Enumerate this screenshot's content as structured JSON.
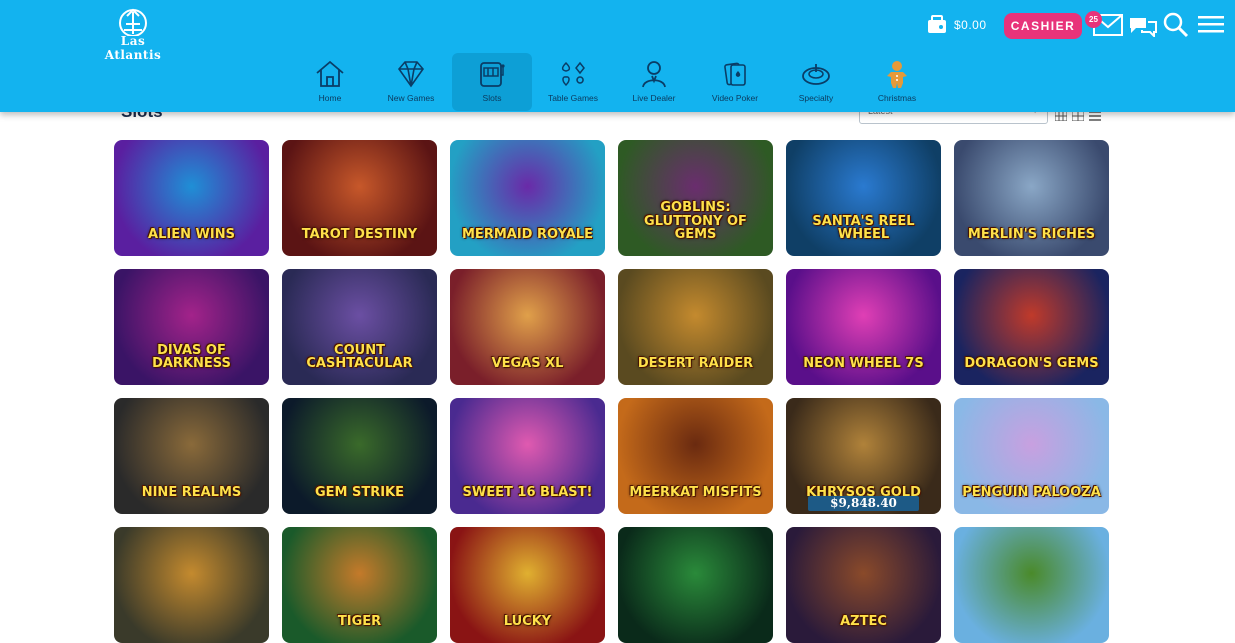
{
  "header": {
    "logo_text": "Las Atlantis",
    "balance": "$0.00",
    "cashier_label": "CASHIER",
    "mail_badge": "25",
    "icons": [
      "wallet-icon",
      "mail-icon",
      "chat-icon",
      "search-icon",
      "menu-icon"
    ]
  },
  "nav": {
    "items": [
      {
        "label": "Home",
        "icon": "home-icon"
      },
      {
        "label": "New Games",
        "icon": "diamond-icon"
      },
      {
        "label": "Slots",
        "icon": "slot-machine-icon",
        "active": true
      },
      {
        "label": "Table Games",
        "icon": "card-suits-icon"
      },
      {
        "label": "Live Dealer",
        "icon": "dealer-icon"
      },
      {
        "label": "Video Poker",
        "icon": "cards-icon"
      },
      {
        "label": "Specialty",
        "icon": "roulette-icon"
      },
      {
        "label": "Christmas",
        "icon": "gingerbread-icon"
      }
    ]
  },
  "content": {
    "heading": "Slots",
    "sort_value": "Latest"
  },
  "games": [
    {
      "title": "Alien Wins",
      "colors": [
        "#5a1fa0",
        "#1f8fd6"
      ]
    },
    {
      "title": "Tarot Destiny",
      "colors": [
        "#5b1414",
        "#c7582a"
      ]
    },
    {
      "title": "Mermaid Royale",
      "colors": [
        "#23a0c4",
        "#6a2aa8"
      ]
    },
    {
      "title": "Goblins: Gluttony of Gems",
      "colors": [
        "#2e5a24",
        "#6a2d6e"
      ]
    },
    {
      "title": "Santa's Reel Wheel",
      "colors": [
        "#0f3f66",
        "#2a7ad0"
      ]
    },
    {
      "title": "Merlin's Riches",
      "colors": [
        "#3a4a6e",
        "#8aa7c6"
      ]
    },
    {
      "title": "Divas of Darkness",
      "colors": [
        "#3a1466",
        "#a3238a"
      ]
    },
    {
      "title": "Count Cashtacular",
      "colors": [
        "#2a2a55",
        "#6b4fa3"
      ]
    },
    {
      "title": "Vegas XL",
      "colors": [
        "#7a1f2a",
        "#e0a04a"
      ]
    },
    {
      "title": "Desert Raider",
      "colors": [
        "#5a4a20",
        "#c48a2e"
      ]
    },
    {
      "title": "Neon Wheel 7s",
      "colors": [
        "#5a0f8a",
        "#e03fb5"
      ]
    },
    {
      "title": "Doragon's Gems",
      "colors": [
        "#1a2460",
        "#c03a2a"
      ]
    },
    {
      "title": "Nine Realms",
      "colors": [
        "#2a2a2a",
        "#8a6a3a"
      ]
    },
    {
      "title": "Gem Strike",
      "colors": [
        "#0c1a2a",
        "#3a6a2a"
      ]
    },
    {
      "title": "Sweet 16 Blast!",
      "colors": [
        "#4a2a90",
        "#e05ab0"
      ]
    },
    {
      "title": "Meerkat Misfits",
      "colors": [
        "#c46a1a",
        "#6a2a10"
      ]
    },
    {
      "title": "Khrysos Gold",
      "colors": [
        "#3a2a1a",
        "#b0823a"
      ],
      "jackpot": "$9,848.40"
    },
    {
      "title": "Penguin Palooza",
      "colors": [
        "#8ab8e6",
        "#c8a0e0"
      ]
    },
    {
      "title": "",
      "colors": [
        "#3a3a2a",
        "#c48a2e"
      ]
    },
    {
      "title": "Tiger",
      "colors": [
        "#1a5a2a",
        "#c47a2a"
      ]
    },
    {
      "title": "Lucky",
      "colors": [
        "#8a1414",
        "#e0b030"
      ]
    },
    {
      "title": "",
      "colors": [
        "#0a2a1a",
        "#2a8a3a"
      ]
    },
    {
      "title": "Aztec",
      "colors": [
        "#2a1a3a",
        "#8a4a2a"
      ]
    },
    {
      "title": "",
      "colors": [
        "#6ab0e0",
        "#4a8a2a"
      ]
    }
  ]
}
